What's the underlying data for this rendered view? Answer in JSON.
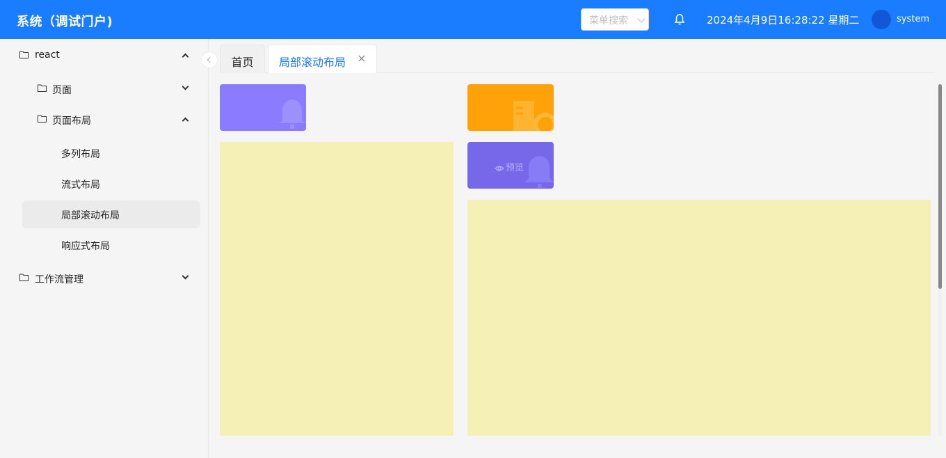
{
  "header": {
    "title": "系统（调试门户)",
    "search_placeholder": "菜单搜索",
    "datetime": "2024年4月9日16:28:22 星期二",
    "username": "system"
  },
  "sidebar": {
    "items": [
      {
        "label": "react",
        "icon": "folder-icon",
        "expanded": true
      },
      {
        "label": "页面",
        "icon": "folder-icon",
        "expanded": false
      },
      {
        "label": "页面布局",
        "icon": "folder-icon",
        "expanded": true
      },
      {
        "label": "多列布局"
      },
      {
        "label": "流式布局"
      },
      {
        "label": "局部滚动布局",
        "active": true
      },
      {
        "label": "响应式布局"
      },
      {
        "label": "工作流管理",
        "icon": "folder-icon",
        "expanded": false
      }
    ]
  },
  "tabs": [
    {
      "label": "首页"
    },
    {
      "label": "局部滚动布局",
      "active": true
    }
  ],
  "content": {
    "preview_label": "预览"
  },
  "colors": {
    "header_bg": "#1a7cff",
    "card_purple": "#8a7bff",
    "card_orange": "#ffa108",
    "card_violet": "#7668e8",
    "panel_yellow": "#f4f0b6",
    "active_tab": "#1677ff"
  }
}
